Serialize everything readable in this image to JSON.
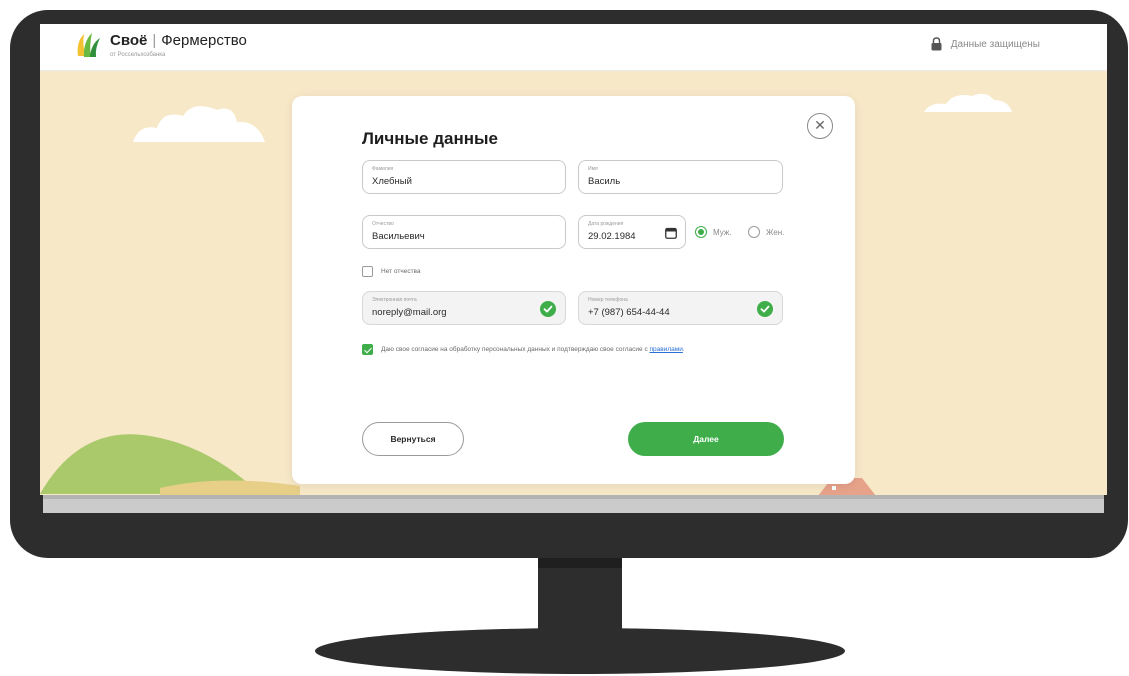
{
  "header": {
    "brand_name": "Своё",
    "brand_product": "Фермерство",
    "brand_sub": "от Россельхозбанка",
    "secure_text": "Данные защищены"
  },
  "modal": {
    "title": "Личные данные",
    "close_icon": "close-icon",
    "fields": {
      "surname": {
        "label": "Фамилия",
        "value": "Хлебный"
      },
      "name": {
        "label": "Имя",
        "value": "Василь"
      },
      "patronymic": {
        "label": "Отчество",
        "value": "Васильевич"
      },
      "birthdate": {
        "label": "Дата рождения",
        "value": "29.02.1984"
      },
      "email": {
        "label": "Электронная почта",
        "value": "noreply@mail.org"
      },
      "phone": {
        "label": "Номер телефона",
        "value": "+7 (987) 654-44-44"
      }
    },
    "gender": {
      "male_label": "Муж.",
      "female_label": "Жен.",
      "selected": "Муж."
    },
    "no_patronymic": {
      "label": "Нет отчества",
      "checked": false
    },
    "consent": {
      "text": "Даю свое согласие на обработку персональных данных и подтверждаю свое согласие с ",
      "link": "правилами",
      "end": ".",
      "checked": true
    },
    "back_button": "Вернуться",
    "next_button": "Далее"
  },
  "colors": {
    "accent": "#3fae4a",
    "screen_background": "#f7e8c8",
    "monitor": "#2d2d2d"
  }
}
